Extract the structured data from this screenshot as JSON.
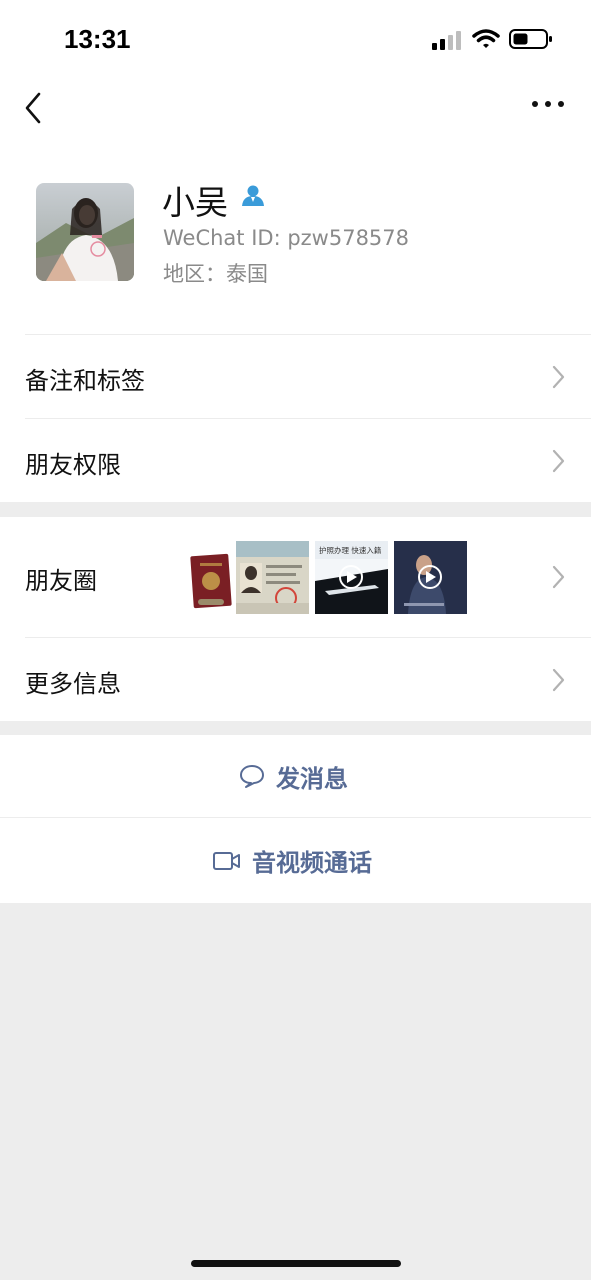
{
  "status_bar": {
    "time": "13:31"
  },
  "profile": {
    "name": "小吴",
    "wechat_id": "WeChat ID: pzw578578",
    "region": "地区：泰国"
  },
  "menu": {
    "remarks_tags": "备注和标签",
    "friend_permissions": "朋友权限",
    "moments": "朋友圈",
    "more_info": "更多信息"
  },
  "moments_thumbs": {
    "video_caption": "护照办理 快速入籍"
  },
  "actions": {
    "send_message": "发消息",
    "video_call": "音视频通话"
  },
  "colors": {
    "link_blue": "#576b95",
    "background": "#ededed",
    "friend_badge": "#3a9bd9"
  }
}
